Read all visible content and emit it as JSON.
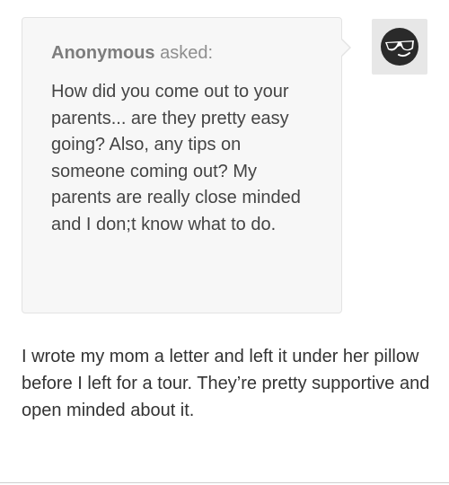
{
  "ask": {
    "asker_name": "Anonymous",
    "asked_label": " asked:",
    "question": "How did you come out to your parents... are they pretty easy going? Also, any tips on someone coming out? My parents are really close minded and I don;t know what to do."
  },
  "avatar": {
    "icon": "sunglasses-face-icon"
  },
  "answer": {
    "text": "I wrote my mom a letter and left it under her pillow before I left for a tour. They’re pretty supportive and open minded about it."
  },
  "colors": {
    "bubble_bg": "#f7f7f7",
    "bubble_border": "#e3e3e3",
    "avatar_bg": "#e7e7e7",
    "asker_text": "#8e8e8e",
    "body_text": "#333333"
  }
}
